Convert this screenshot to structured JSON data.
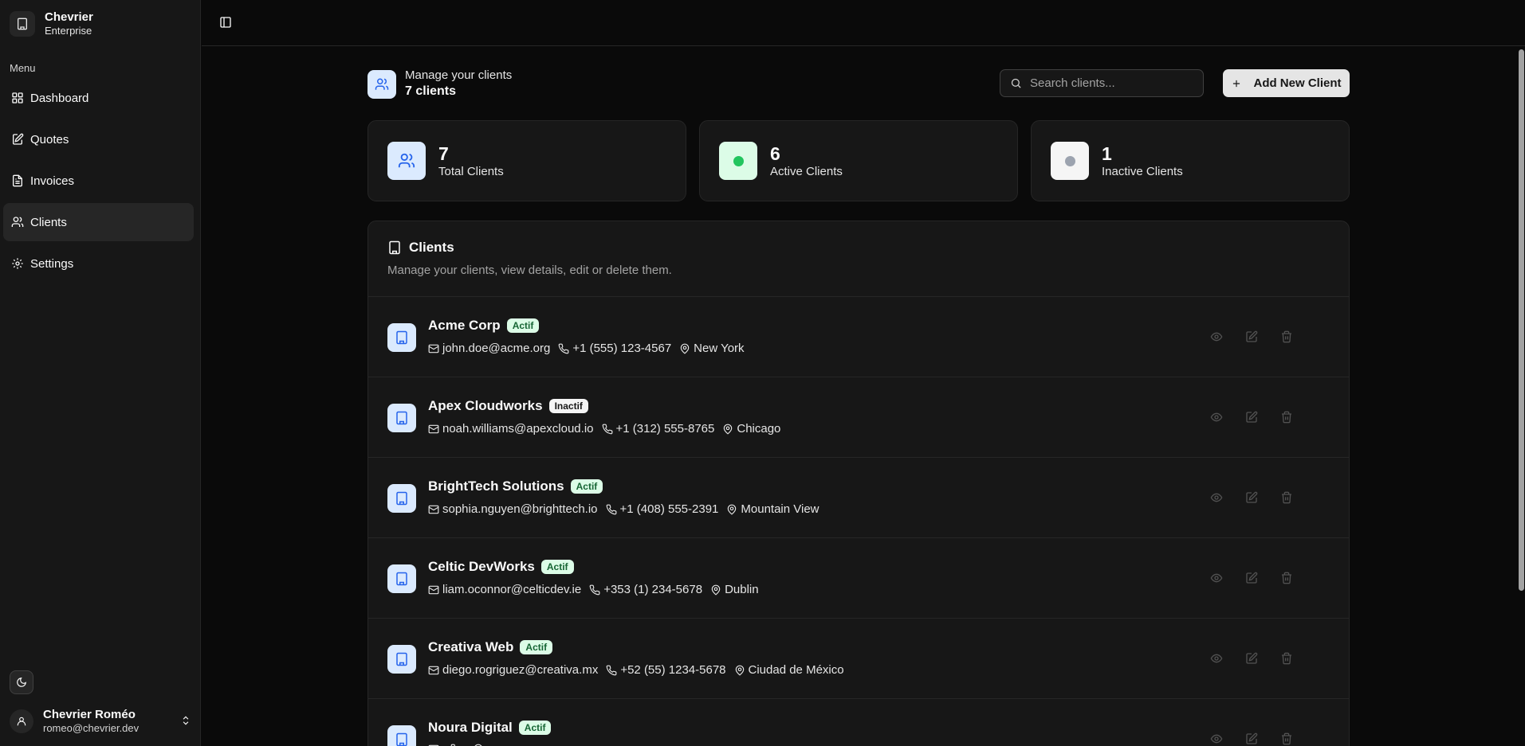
{
  "brand": {
    "name": "Chevrier",
    "subtitle": "Enterprise"
  },
  "sidebar": {
    "menu_label": "Menu",
    "items": [
      {
        "label": "Dashboard",
        "icon": "grid-icon"
      },
      {
        "label": "Quotes",
        "icon": "file-edit-icon"
      },
      {
        "label": "Invoices",
        "icon": "file-text-icon"
      },
      {
        "label": "Clients",
        "icon": "users-icon",
        "active": true
      },
      {
        "label": "Settings",
        "icon": "gear-icon"
      }
    ]
  },
  "user": {
    "name": "Chevrier Roméo",
    "email": "romeo@chevrier.dev"
  },
  "header": {
    "subtitle": "Manage your clients",
    "count": "7 clients"
  },
  "search": {
    "placeholder": "Search clients..."
  },
  "add_button": {
    "label": "Add New Client"
  },
  "stats": [
    {
      "value": "7",
      "label": "Total Clients"
    },
    {
      "value": "6",
      "label": "Active Clients"
    },
    {
      "value": "1",
      "label": "Inactive Clients"
    }
  ],
  "clients_card": {
    "title": "Clients",
    "description": "Manage your clients, view details, edit or delete them."
  },
  "clients": [
    {
      "name": "Acme Corp",
      "status": "Actif",
      "email": "john.doe@acme.org",
      "phone": "+1 (555) 123-4567",
      "city": "New York"
    },
    {
      "name": "Apex Cloudworks",
      "status": "Inactif",
      "email": "noah.williams@apexcloud.io",
      "phone": "+1 (312) 555-8765",
      "city": "Chicago"
    },
    {
      "name": "BrightTech Solutions",
      "status": "Actif",
      "email": "sophia.nguyen@brighttech.io",
      "phone": "+1 (408) 555-2391",
      "city": "Mountain View"
    },
    {
      "name": "Celtic DevWorks",
      "status": "Actif",
      "email": "liam.oconnor@celticdev.ie",
      "phone": "+353 (1) 234-5678",
      "city": "Dublin"
    },
    {
      "name": "Creativa Web",
      "status": "Actif",
      "email": "diego.rogriguez@creativa.mx",
      "phone": "+52 (55) 1234-5678",
      "city": "Ciudad de México"
    },
    {
      "name": "Noura Digital",
      "status": "Actif",
      "email": "",
      "phone": "",
      "city": ""
    }
  ],
  "colors": {
    "accent": "#2563eb",
    "active_green": "#22c55e",
    "inactive_gray": "#9ca3af"
  }
}
